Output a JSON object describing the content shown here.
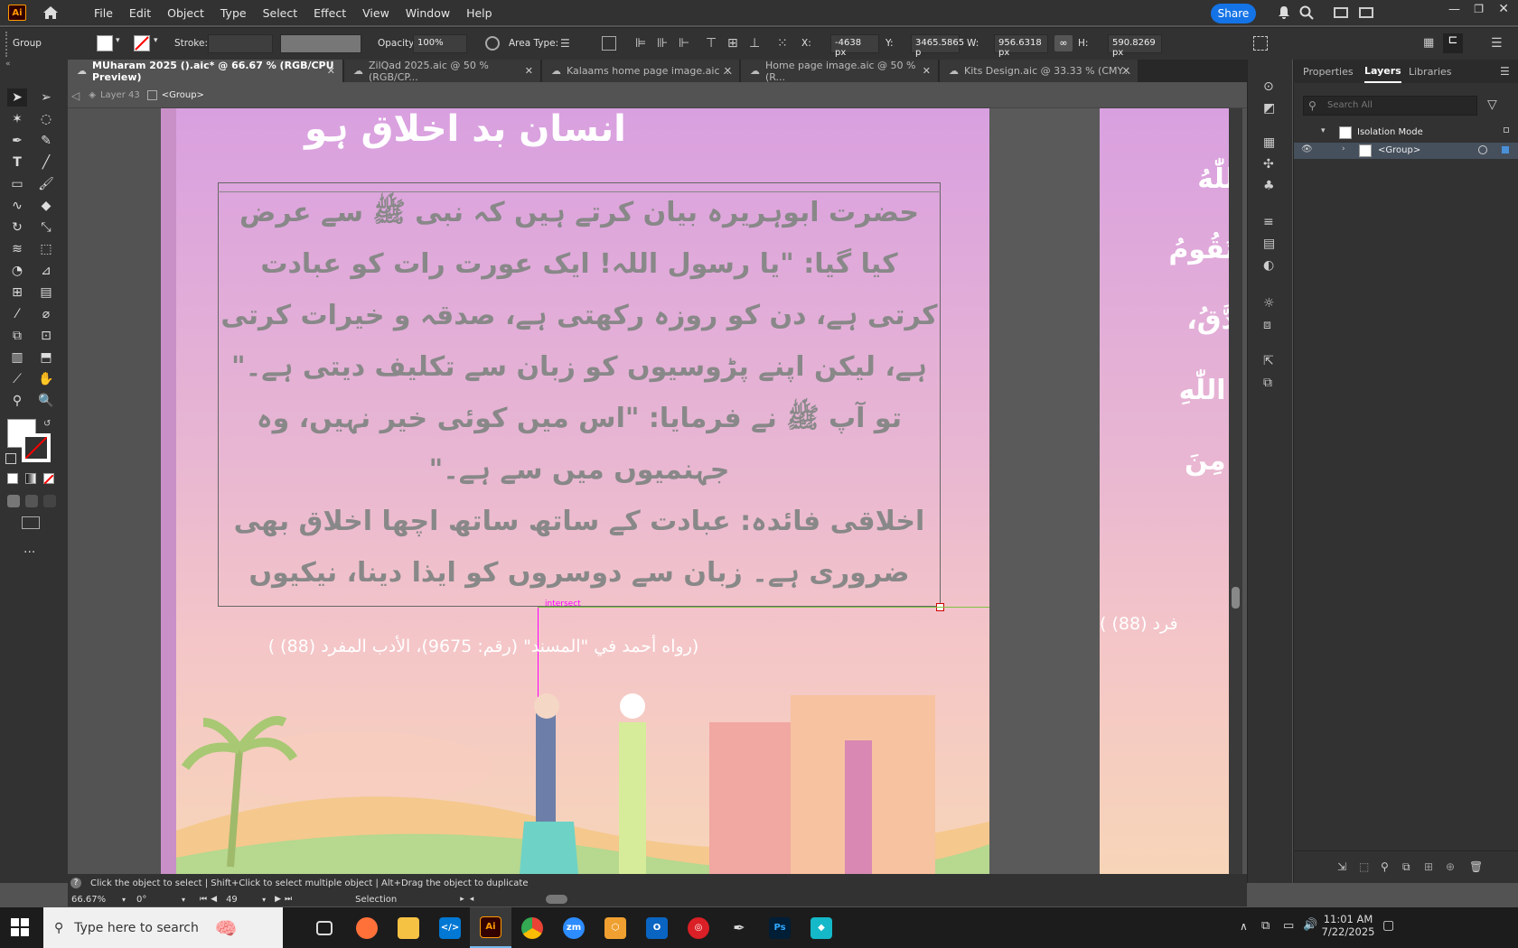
{
  "app": {
    "logo": "Ai",
    "menus": [
      "File",
      "Edit",
      "Object",
      "Type",
      "Select",
      "Effect",
      "View",
      "Window",
      "Help"
    ],
    "share": "Share"
  },
  "control": {
    "selection_type": "Group",
    "stroke_label": "Stroke:",
    "opacity_label": "Opacity:",
    "opacity_value": "100%",
    "area_type_label": "Area Type:",
    "x_label": "X:",
    "x_value": "-4638 px",
    "y_label": "Y:",
    "y_value": "3465.5865 p",
    "w_label": "W:",
    "w_value": "956.6318 px",
    "h_label": "H:",
    "h_value": "590.8269 px"
  },
  "tabs": [
    {
      "label": "MUharam 2025 ().aic* @ 66.67 % (RGB/CPU Preview)",
      "active": true
    },
    {
      "label": "ZilQad 2025.aic @ 50 % (RGB/CP...",
      "active": false
    },
    {
      "label": "Kalaams home page image.aic ...",
      "active": false
    },
    {
      "label": "Home page image.aic @ 50 % (R...",
      "active": false
    },
    {
      "label": "Kits Design.aic @ 33.33 % (CMY...",
      "active": false
    }
  ],
  "breadcrumb": {
    "layer": "Layer 43",
    "group": "<Group>"
  },
  "artwork": {
    "heading": "انسان بد اخلاق ہو",
    "paragraph": [
      "حضرت ابوہریرہ بیان کرتے ہیں کہ نبی ﷺ سے عرض",
      "کیا گیا: \"یا رسول اللہ! ایک عورت رات کو عبادت",
      "کرتی ہے، دن کو روزہ رکھتی ہے، صدقہ و خیرات کرتی",
      "ہے، لیکن اپنے پڑوسیوں کو زبان سے تکلیف دیتی ہے۔\"",
      "تو آپ ﷺ نے فرمایا: \"اس میں کوئی خیر نہیں، وہ",
      "جہنمیوں میں سے ہے۔\"",
      "اخلاقی فائدہ: عبادت کے ساتھ ساتھ اچھا اخلاق بھی",
      "ضروری ہے۔ زبان سے دوسروں کو ایذا دینا، نیکیوں"
    ],
    "reference": "(رواه أحمد في \"المسند\" (رقم: 9675)، الأدب المفرد (88) )",
    "smart_guide": "intersect",
    "art2_lines": [
      "للّٰهُ",
      "تَقُومُ",
      "دَّقُ،",
      "ُ اللّٰهِ",
      "ُ مِنَ"
    ],
    "art2_ref": "فرد (88) )"
  },
  "panel": {
    "tabs": [
      "Properties",
      "Layers",
      "Libraries"
    ],
    "active_tab": "Layers",
    "search_placeholder": "Search All",
    "rows": [
      {
        "label": "Isolation Mode"
      },
      {
        "label": "<Group>"
      }
    ]
  },
  "status": {
    "hint": "Click the object to select  |  Shift+Click to select multiple object  |  Alt+Drag the object to duplicate",
    "zoom": "66.67%",
    "rotate": "0°",
    "artboard": "49",
    "tool": "Selection"
  },
  "taskbar": {
    "search_placeholder": "Type here to search",
    "time": "11:01 AM",
    "date": "7/22/2025"
  },
  "colors": {
    "accent": "#1473e6",
    "guide": "#ff00ff",
    "smart_guide": "#7fc241"
  }
}
